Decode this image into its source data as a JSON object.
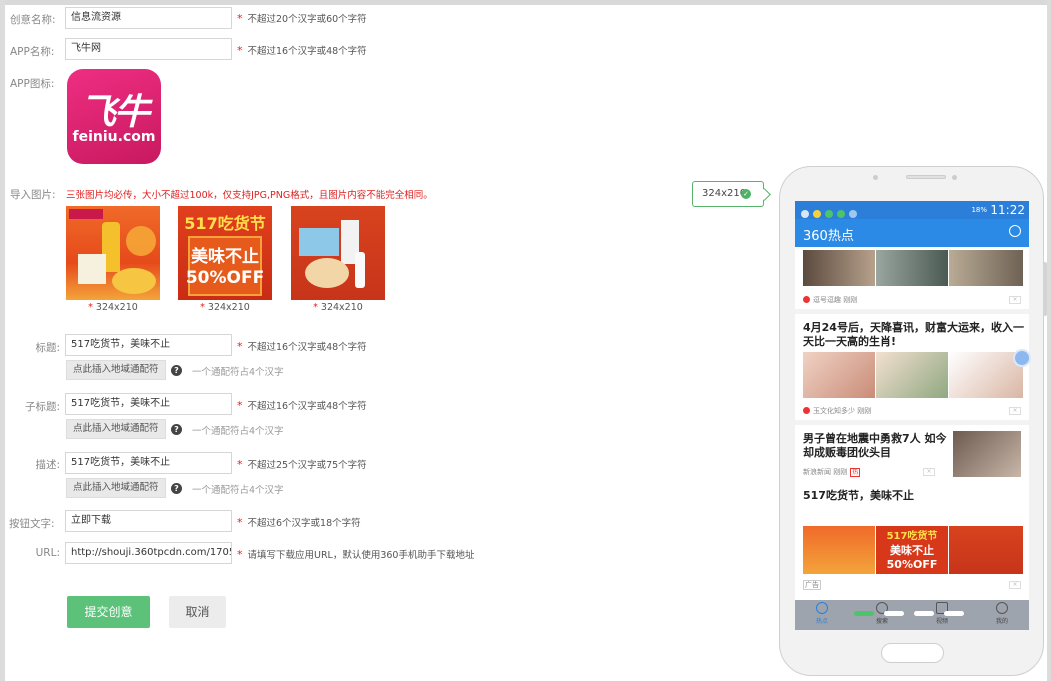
{
  "form": {
    "creative_name": {
      "label": "创意名称:",
      "value": "信息流资源",
      "hint": "不超过20个汉字或60个字符"
    },
    "app_name": {
      "label": "APP名称:",
      "value": "飞牛网",
      "hint": "不超过16个汉字或48个字符"
    },
    "app_icon": {
      "label": "APP图标:",
      "brand_big": "飞牛",
      "brand_small": "feiniu.com"
    },
    "import_images": {
      "label": "导入图片:",
      "requirement": "三张图片均必传，大小不超过100k，仅支持JPG,PNG格式，且图片内容不能完全相同。",
      "images": [
        {
          "size": "324x210",
          "alt": "飞牛网"
        },
        {
          "size": "324x210",
          "line1": "517吃货节",
          "line2": "美味不止",
          "line3": "50%OFF"
        },
        {
          "size": "324x210"
        }
      ]
    },
    "title": {
      "label": "标题:",
      "value": "517吃货节，美味不止",
      "hint": "不超过16个汉字或48个字符"
    },
    "subtitle": {
      "label": "子标题:",
      "value": "517吃货节，美味不止",
      "hint": "不超过16个汉字或48个字符"
    },
    "description": {
      "label": "描述:",
      "value": "517吃货节，美味不止",
      "hint": "不超过25个汉字或75个字符"
    },
    "insert_region_button": "点此插入地域通配符",
    "wildcard_help": "一个通配符占4个汉字",
    "button_text": {
      "label": "按钮文字:",
      "value": "立即下载",
      "hint": "不超过6个汉字或18个字符"
    },
    "url": {
      "label": "URL:",
      "value": "http://shouji.360tpcdn.com/170517",
      "hint": "请填写下载应用URL，默认使用360手机助手下载地址"
    },
    "submit": "提交创意",
    "cancel": "取消",
    "required_mark": "*"
  },
  "size_tag": {
    "text": "324x210",
    "check": "✓"
  },
  "preview": {
    "status_time": "11:22",
    "status_pct": "18%",
    "app_title": "360热点",
    "feed": [
      {
        "source": "逗号逗趣",
        "time": "刚刚"
      },
      {
        "title_line1": "4月24号后，天降喜讯，财富大运来，收入一",
        "title_line2": "天比一天高的生肖!",
        "source": "玉文化知多少",
        "time": "刚刚"
      },
      {
        "title_line1": "男子曾在地震中勇救7人 如今",
        "title_line2": "却成贩毒团伙头目",
        "source": "新浪新闻",
        "time": "刚刚",
        "tag": "热"
      },
      {
        "title": "517吃货节，美味不止",
        "ad_tag": "广告",
        "banner_line1": "517吃货节",
        "banner_line2": "美味不止",
        "banner_line3": "50%OFF"
      }
    ],
    "nav": [
      "热点",
      "搜索",
      "视频",
      "我的"
    ]
  },
  "colors": {
    "accent_green": "#5cc27a",
    "required_red": "#e02020",
    "phone_blue": "#2b7fd9"
  }
}
